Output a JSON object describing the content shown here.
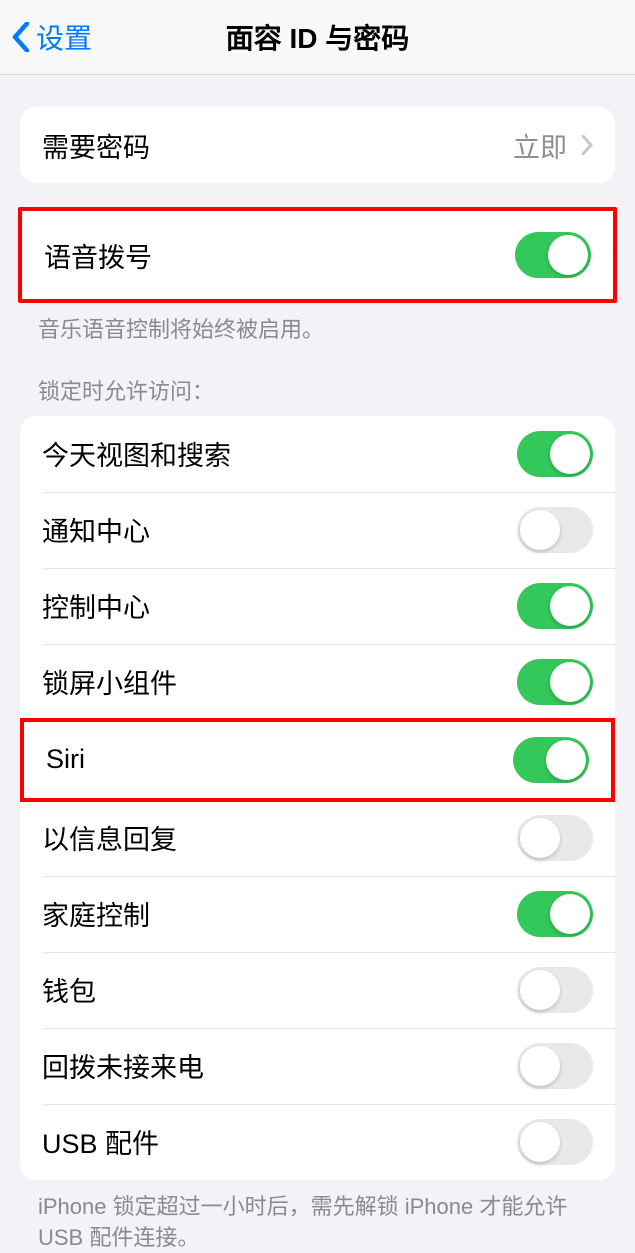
{
  "nav": {
    "back_label": "设置",
    "title": "面容 ID 与密码"
  },
  "passcode": {
    "label": "需要密码",
    "value": "立即"
  },
  "voice_dial": {
    "label": "语音拨号",
    "on": true,
    "footer": "音乐语音控制将始终被启用。"
  },
  "lock_header": "锁定时允许访问：",
  "lock_items": [
    {
      "label": "今天视图和搜索",
      "on": true,
      "highlight": false
    },
    {
      "label": "通知中心",
      "on": false,
      "highlight": false
    },
    {
      "label": "控制中心",
      "on": true,
      "highlight": false
    },
    {
      "label": "锁屏小组件",
      "on": true,
      "highlight": false
    },
    {
      "label": "Siri",
      "on": true,
      "highlight": true
    },
    {
      "label": "以信息回复",
      "on": false,
      "highlight": false
    },
    {
      "label": "家庭控制",
      "on": true,
      "highlight": false
    },
    {
      "label": "钱包",
      "on": false,
      "highlight": false
    },
    {
      "label": "回拨未接来电",
      "on": false,
      "highlight": false
    },
    {
      "label": "USB 配件",
      "on": false,
      "highlight": false
    }
  ],
  "lock_footer": "iPhone 锁定超过一小时后，需先解锁 iPhone 才能允许 USB 配件连接。"
}
